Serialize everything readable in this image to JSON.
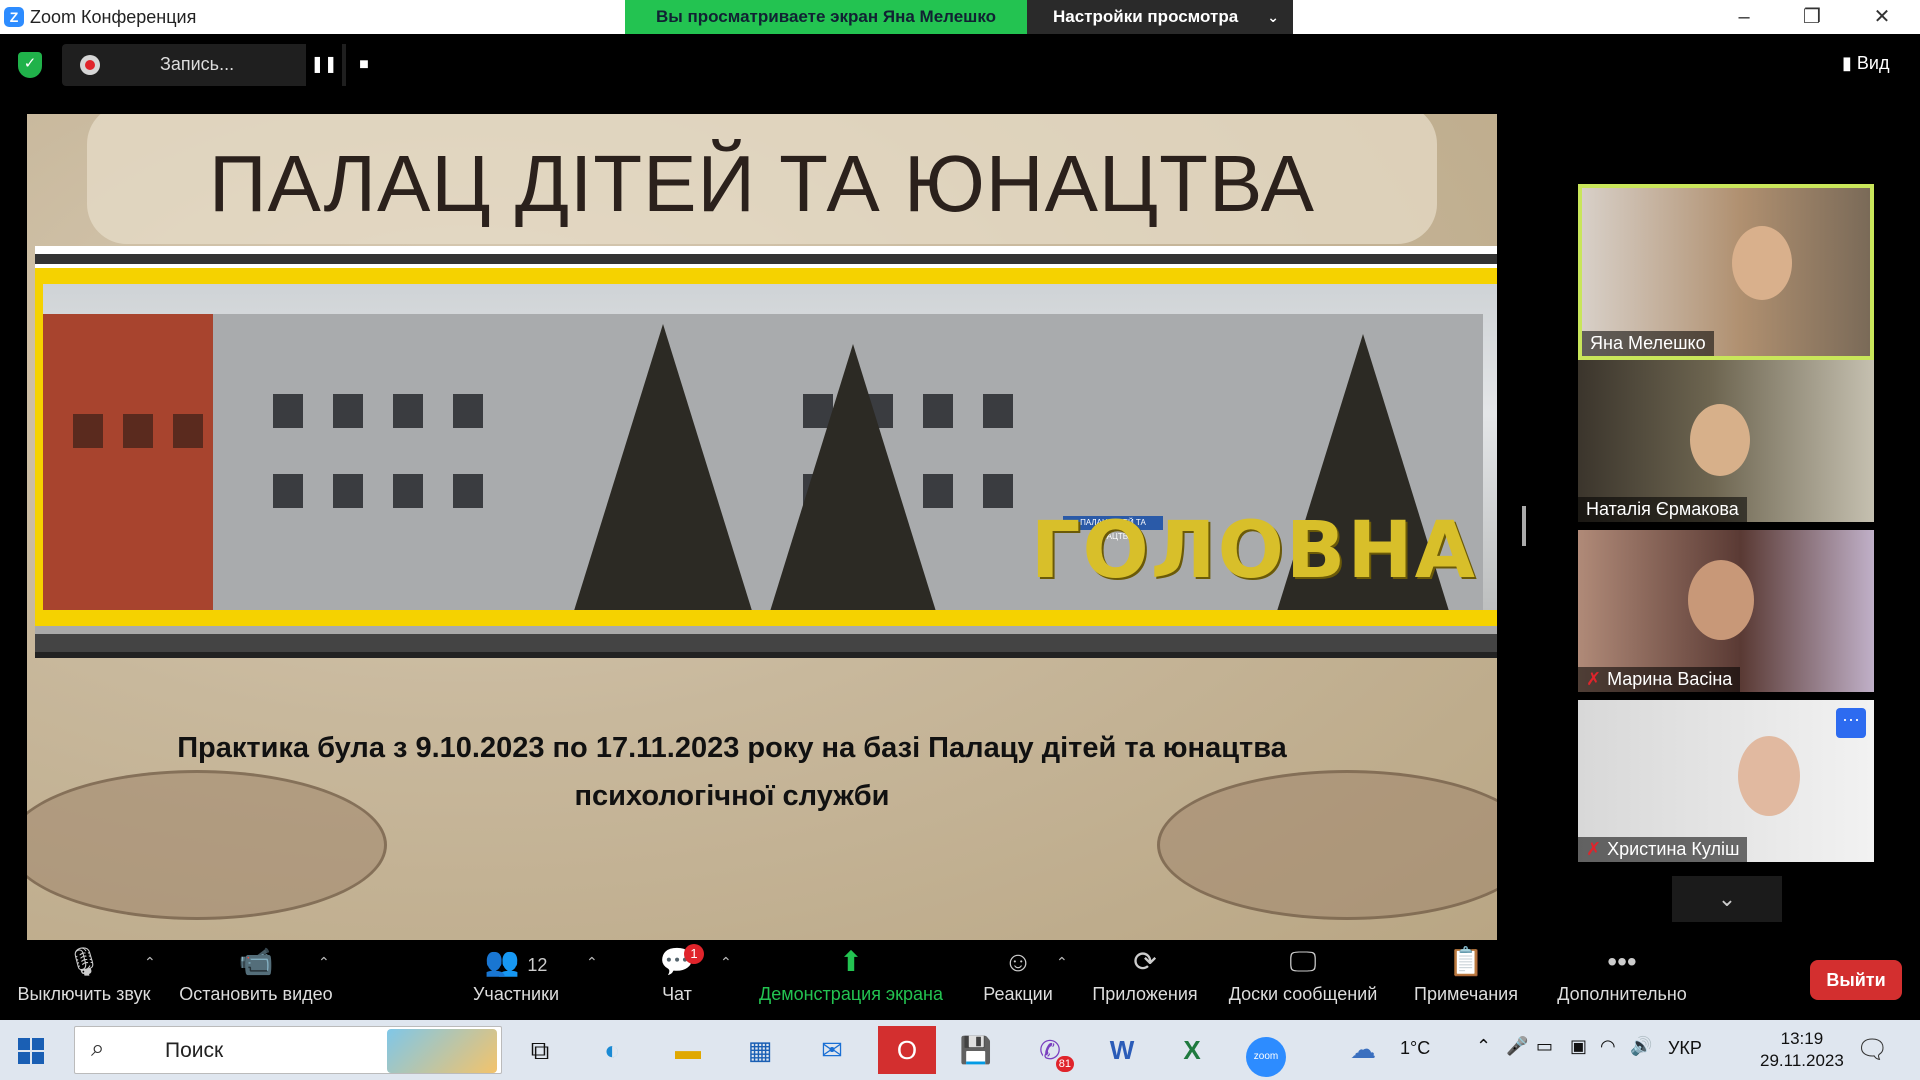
{
  "window": {
    "title": "Zoom Конференция",
    "logo_letter": "Z"
  },
  "share_banner": {
    "viewing_text": "Вы просматриваете экран Яна Мелешко",
    "view_settings_label": "Настройки просмотра"
  },
  "recording": {
    "label": "Запись...",
    "pause_symbol": "❚❚",
    "stop_symbol": "■"
  },
  "view_button": {
    "label": "Вид"
  },
  "slide": {
    "title": "ПАЛАЦ ДІТЕЙ ТА ЮНАЦТВА",
    "photo_label": "ГОЛОВНА",
    "sign_text": "ПАЛАЦ ДІТЕЙ ТА ЮНАЦТВА",
    "caption_line1": "Практика була  з 9.10.2023 по 17.11.2023 року на базі Палацу дітей та юнацтва",
    "caption_line2": "психологічної служби"
  },
  "participants": [
    {
      "name": "Яна Мелешко",
      "active": true,
      "muted": false
    },
    {
      "name": "Наталія  Єрмакова",
      "active": false,
      "muted": false
    },
    {
      "name": "Марина Васіна",
      "active": false,
      "muted": true
    },
    {
      "name": "Христина Куліш",
      "active": false,
      "muted": true
    }
  ],
  "toolbar": {
    "mute_label": "Выключить звук",
    "video_label": "Остановить видео",
    "participants_label": "Участники",
    "participants_count": "12",
    "chat_label": "Чат",
    "chat_badge": "1",
    "share_label": "Демонстрация экрана",
    "reactions_label": "Реакции",
    "apps_label": "Приложения",
    "whiteboards_label": "Доски сообщений",
    "notes_label": "Примечания",
    "more_label": "Дополнительно",
    "leave_label": "Выйти"
  },
  "taskbar": {
    "search_placeholder": "Поиск",
    "weather_temp": "1°C",
    "language": "УКР",
    "time": "13:19",
    "date": "29.11.2023",
    "viber_badge": "81",
    "zoom_label": "zoom"
  },
  "colors": {
    "share_green": "#23c351",
    "active_speaker_border": "#c9e65a",
    "leave_red": "#d32f2f",
    "slide_yellow": "#f5d200"
  }
}
